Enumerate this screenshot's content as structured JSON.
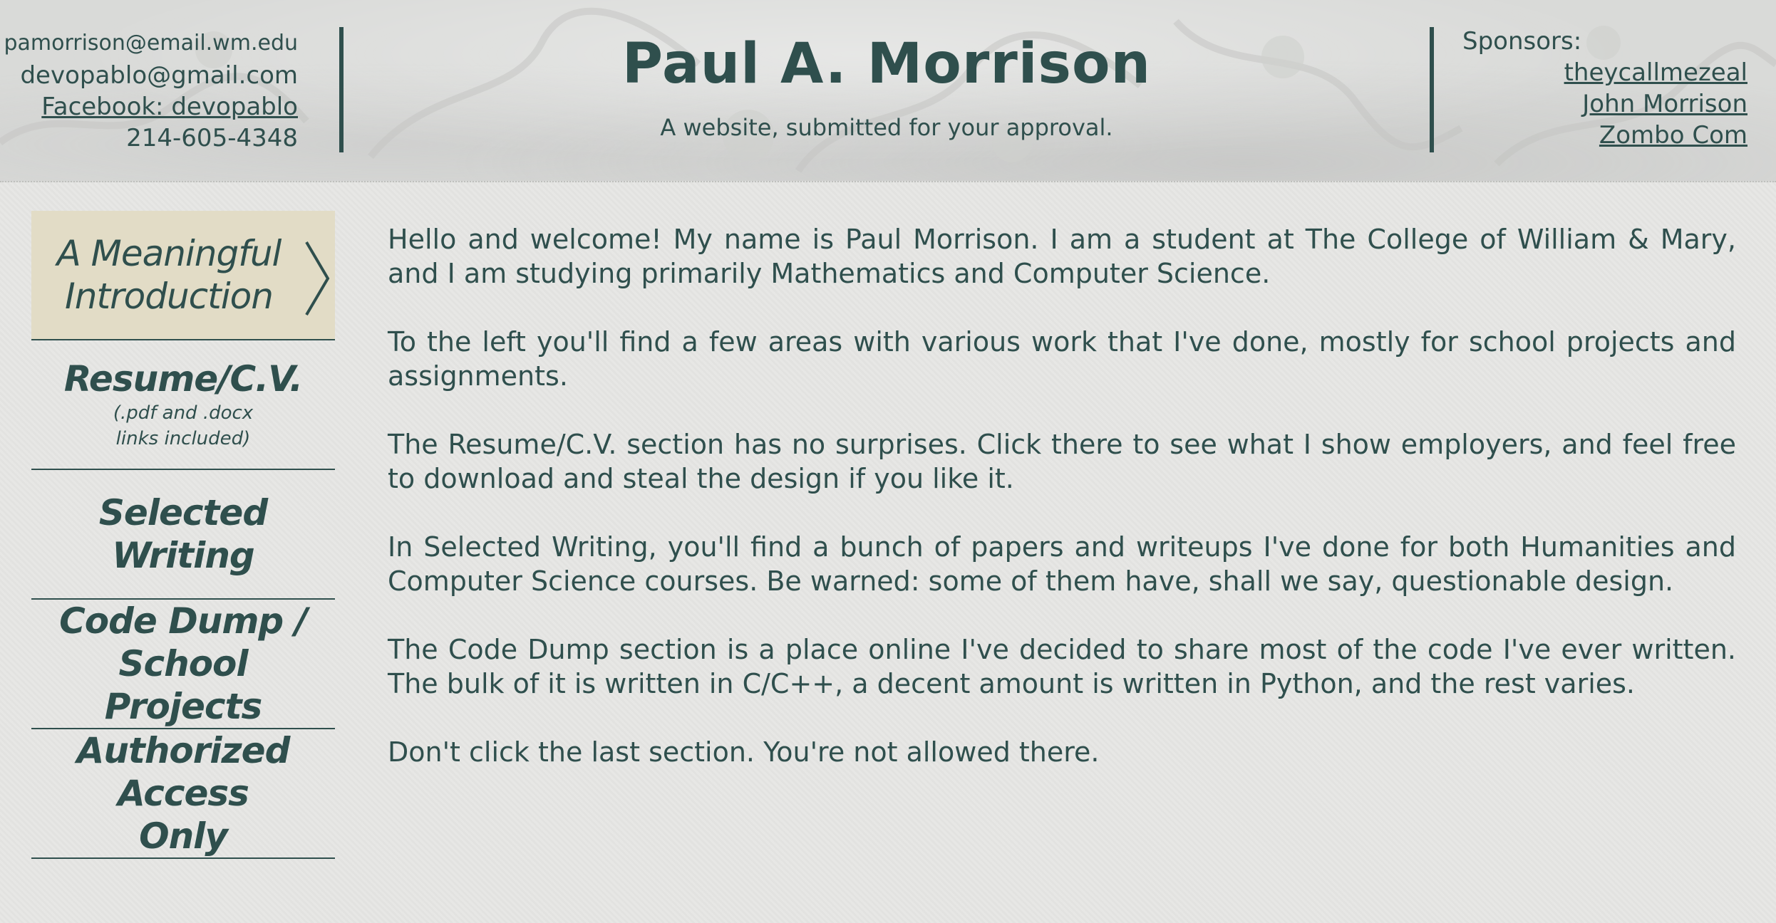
{
  "header": {
    "contact": {
      "email_school": "pamorrison@email.wm.edu",
      "email_gmail": "devopablo@gmail.com",
      "facebook": "Facebook: devopablo",
      "phone": "214-605-4348"
    },
    "title": "Paul A. Morrison",
    "subtitle": "A website, submitted for your approval.",
    "sponsors": {
      "label": "Sponsors:",
      "links": [
        "theycallmezeal",
        "John Morrison",
        "Zombo Com"
      ]
    }
  },
  "sidebar": {
    "items": [
      {
        "label": "A Meaningful Introduction",
        "active": true
      },
      {
        "label": "Resume/C.V.",
        "sub": "(.pdf and .docx links included)"
      },
      {
        "label": "Selected Writing"
      },
      {
        "label": "Code Dump / School Projects"
      },
      {
        "label": "Authorized Access Only"
      }
    ],
    "active_indicator_icon": "chevron-right-icon"
  },
  "main": {
    "paragraphs": [
      "Hello and welcome! My name is Paul Morrison. I am a student at The College of William & Mary, and I am studying primarily Mathematics and Computer Science.",
      "To the left you'll find a few areas with various work that I've done, mostly for school projects and assignments.",
      "The Resume/C.V. section has no surprises. Click there to see what I show employers, and feel free to download and steal the design if you like it.",
      "In Selected Writing, you'll find a bunch of papers and writeups I've done for both Humanities and Computer Science courses. Be warned: some of them have, shall we say, questionable design.",
      "The Code Dump section is a place online I've decided to share most of the code I've ever written. The bulk of it is written in C/C++, a decent amount is written in Python, and the rest varies.",
      "Don't click the last section. You're not allowed there."
    ]
  },
  "colors": {
    "text": "#2f4f4d",
    "active_nav_bg": "#e2dcc6",
    "page_bg": "#e6e6e4",
    "header_bg": "#d9dad8"
  }
}
